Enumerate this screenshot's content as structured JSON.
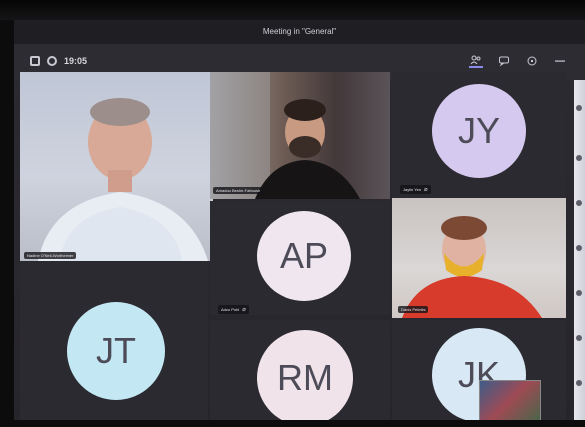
{
  "window": {
    "title": "Meeting in \"General\""
  },
  "toolbar": {
    "timer": "19:05",
    "buttons": [
      {
        "name": "participants-icon"
      },
      {
        "name": "chat-icon"
      },
      {
        "name": "camera-icon"
      },
      {
        "name": "more-icon"
      }
    ]
  },
  "participants": [
    {
      "id": "p1",
      "type": "video",
      "name": "Nadine O'Neil-Wortheimer"
    },
    {
      "id": "p2",
      "type": "video",
      "name": "Amadou Beshir-Fattoush"
    },
    {
      "id": "p3",
      "type": "avatar",
      "initials": "JY",
      "name": "Jaylin Yen",
      "color": "#d6c9ef"
    },
    {
      "id": "p4",
      "type": "avatar",
      "initials": "AP",
      "name": "Adzo Pohl",
      "color": "#efe6ef"
    },
    {
      "id": "p5",
      "type": "video",
      "name": "Danis Pelmits"
    },
    {
      "id": "p6",
      "type": "avatar",
      "initials": "JT",
      "name": "",
      "color": "#c3e8f4"
    },
    {
      "id": "p7",
      "type": "avatar",
      "initials": "RM",
      "name": "",
      "color": "#f0e3ea"
    },
    {
      "id": "p8",
      "type": "avatar",
      "initials": "JK",
      "name": "",
      "color": "#d8e8f5"
    }
  ],
  "colors": {
    "background": "#29282e",
    "toolbar": "#2d2c32",
    "accent": "#8b8ce8"
  }
}
